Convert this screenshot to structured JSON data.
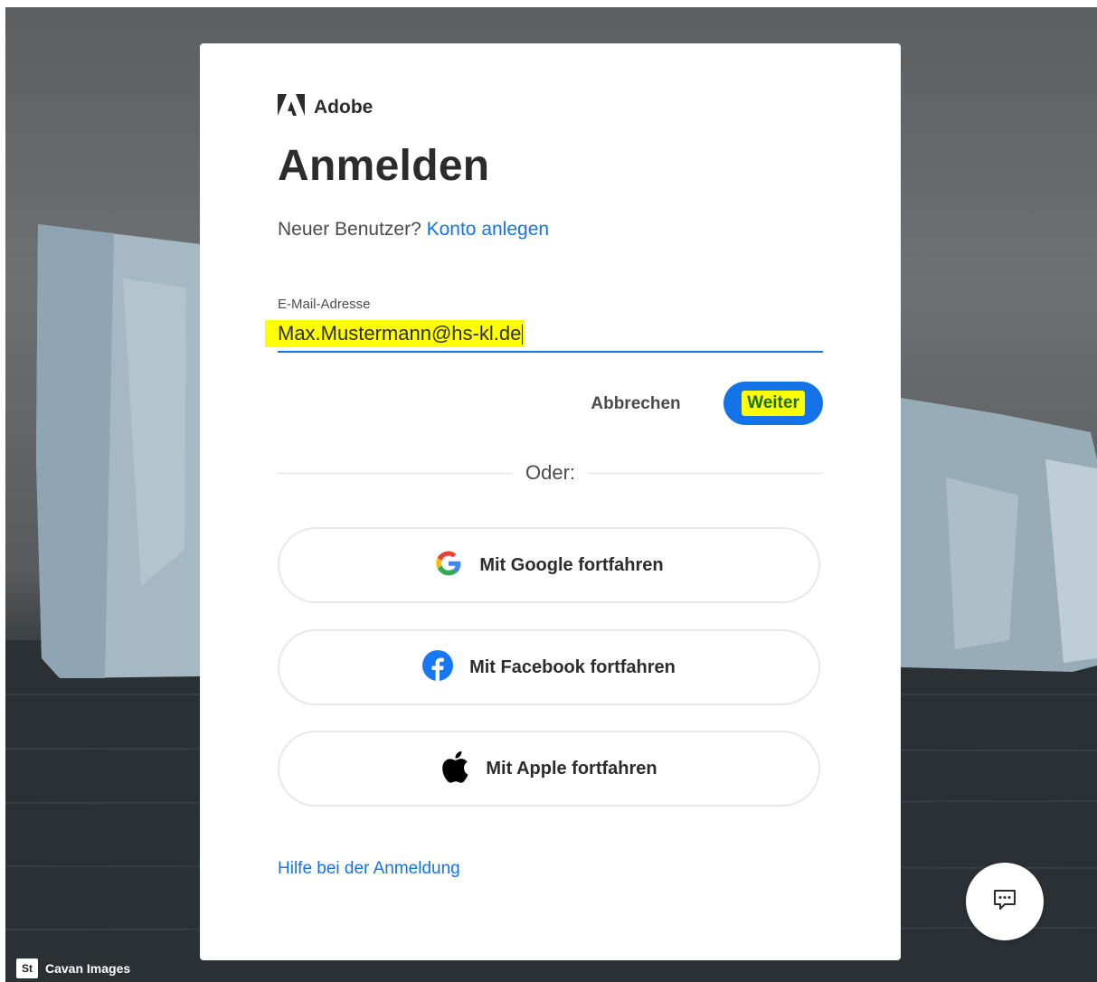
{
  "background": {
    "credit_badge": "St",
    "credit_text": "Cavan Images"
  },
  "brand": {
    "name": "Adobe"
  },
  "signin": {
    "title": "Anmelden",
    "new_user_text": "Neuer Benutzer?",
    "create_account_link": "Konto anlegen",
    "email_label": "E-Mail-Adresse",
    "email_value": "Max.Mustermann@hs-kl.de",
    "cancel_label": "Abbrechen",
    "next_label": "Weiter",
    "or_label": "Oder:",
    "google_label": "Mit Google fortfahren",
    "facebook_label": "Mit Facebook fortfahren",
    "apple_label": "Mit Apple fortfahren",
    "help_link": "Hilfe bei der Anmeldung"
  },
  "icons": {
    "adobe": "adobe-logo-icon",
    "google": "google-icon",
    "facebook": "facebook-icon",
    "apple": "apple-icon",
    "chat": "chat-icon"
  },
  "colors": {
    "accent": "#1473e6",
    "highlight": "#ffff00",
    "next_text_highlight": "#1a6e1a"
  }
}
